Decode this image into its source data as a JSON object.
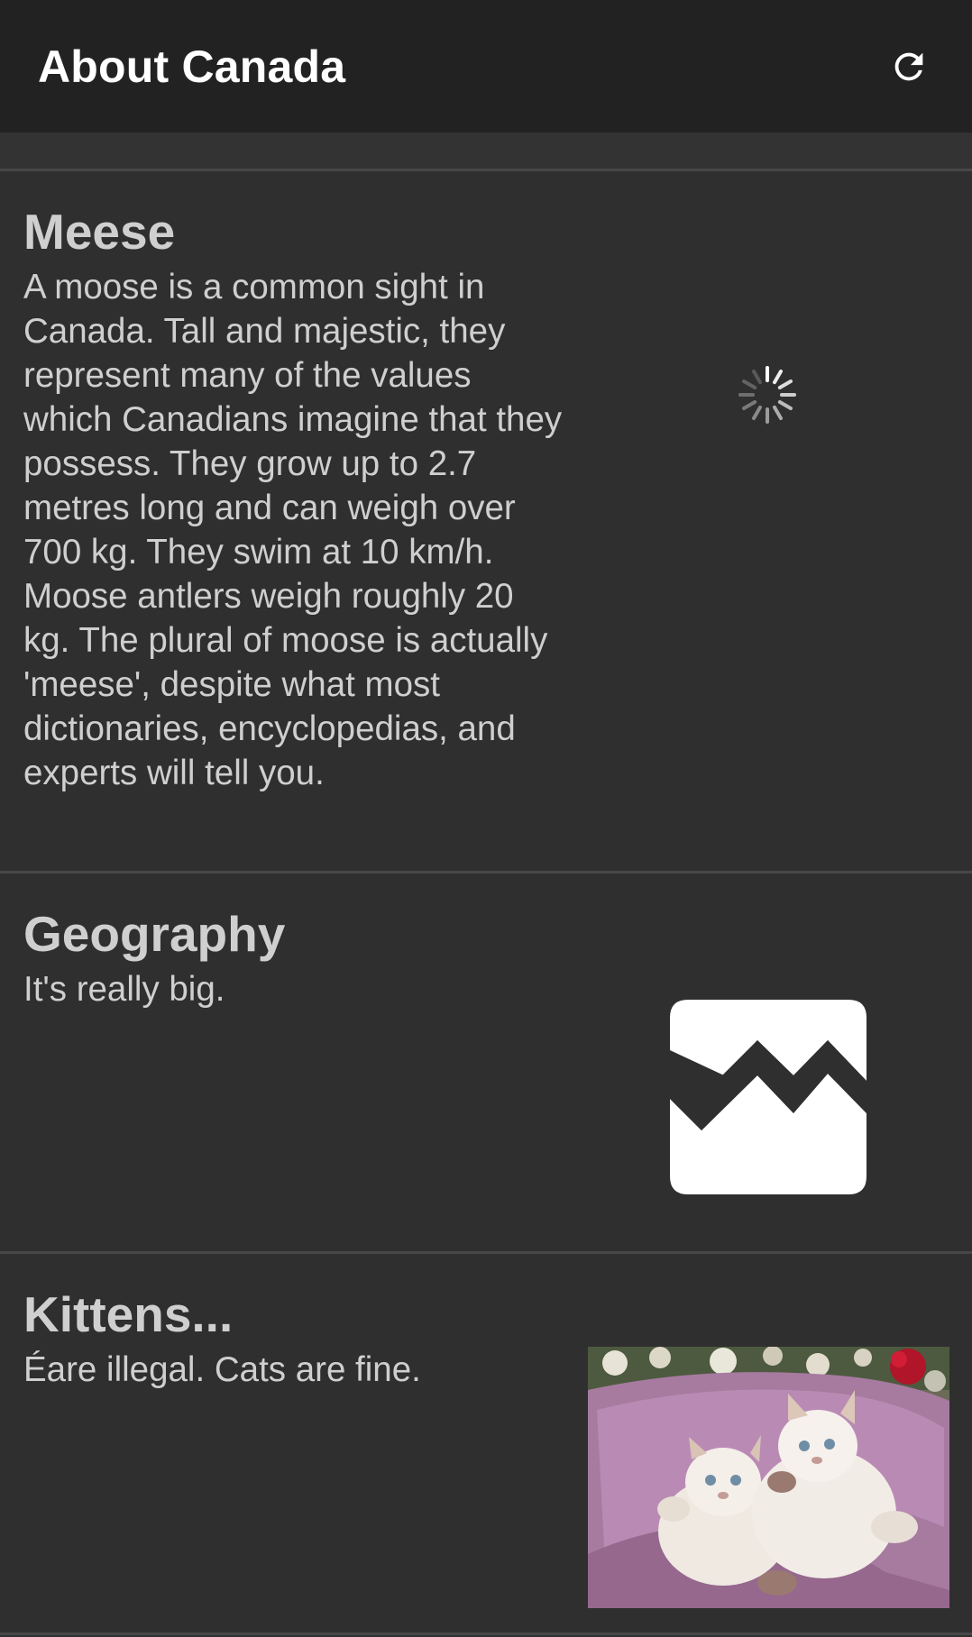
{
  "app_bar": {
    "title": "About Canada",
    "refresh_icon": "refresh-icon"
  },
  "rows": [
    {
      "title": "Meese",
      "description": "A moose is a common sight in Canada. Tall and majestic, they represent many of the values which Canadians imagine that they possess. They grow up to 2.7 metres long and can weigh over 700 kg. They swim at 10 km/h. Moose antlers weigh roughly 20 kg. The plural of moose is actually 'meese', despite what most dictionaries, encyclopedias, and experts will tell you.",
      "image_state": "loading-spinner-icon"
    },
    {
      "title": "Geography",
      "description": "It's really big.",
      "image_state": "broken-image-icon"
    },
    {
      "title": "Kittens...",
      "description": "Éare illegal. Cats are fine.",
      "image_state": "kittens-photo"
    }
  ],
  "colors": {
    "app_bar_bg": "#222222",
    "page_bg": "#2f2f2f",
    "divider": "#474747",
    "text": "#cfcfcf",
    "title_text": "#ffffff"
  }
}
